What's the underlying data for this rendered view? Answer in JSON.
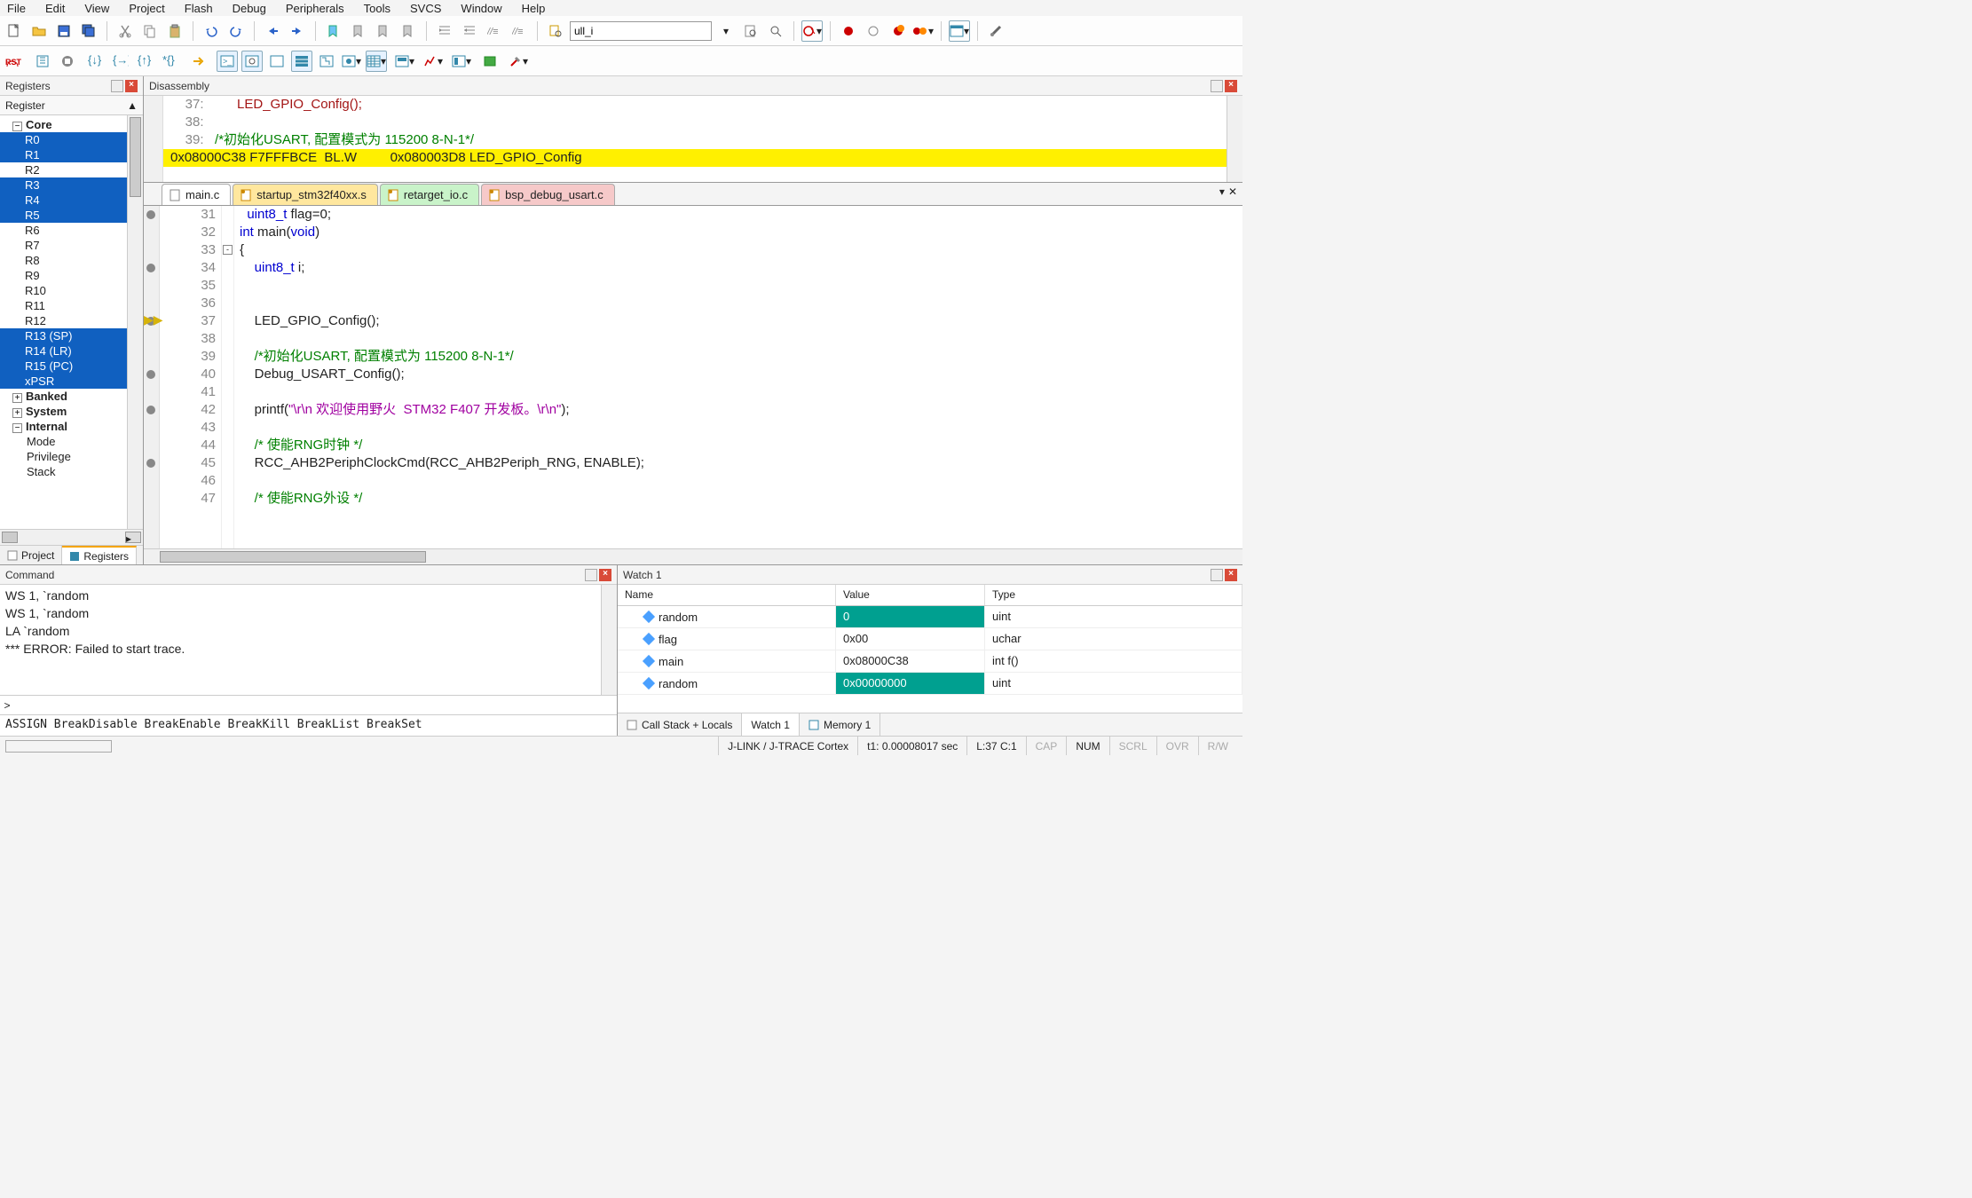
{
  "menu": [
    "File",
    "Edit",
    "View",
    "Project",
    "Flash",
    "Debug",
    "Peripherals",
    "Tools",
    "SVCS",
    "Window",
    "Help"
  ],
  "toolbar_input": "ull_i",
  "registers": {
    "panel_title": "Registers",
    "head": "Register",
    "core": "Core",
    "rows": [
      {
        "t": "R0",
        "s": true
      },
      {
        "t": "R1",
        "s": true
      },
      {
        "t": "R2",
        "s": false
      },
      {
        "t": "R3",
        "s": true
      },
      {
        "t": "R4",
        "s": true
      },
      {
        "t": "R5",
        "s": true
      },
      {
        "t": "R6",
        "s": false
      },
      {
        "t": "R7",
        "s": false
      },
      {
        "t": "R8",
        "s": false
      },
      {
        "t": "R9",
        "s": false
      },
      {
        "t": "R10",
        "s": false
      },
      {
        "t": "R11",
        "s": false
      },
      {
        "t": "R12",
        "s": false
      },
      {
        "t": "R13 (SP)",
        "s": true
      },
      {
        "t": "R14 (LR)",
        "s": true
      },
      {
        "t": "R15 (PC)",
        "s": true
      },
      {
        "t": "xPSR",
        "s": true
      }
    ],
    "groups": [
      "Banked",
      "System",
      "Internal"
    ],
    "internal": [
      "Mode",
      "Privilege",
      "Stack"
    ],
    "tabs": {
      "project": "Project",
      "registers": "Registers"
    }
  },
  "disasm": {
    "title": "Disassembly",
    "lines": [
      {
        "n": "    37:",
        "txt": "         LED_GPIO_Config();",
        "cls": "fn"
      },
      {
        "n": "    38:",
        "txt": "",
        "cls": ""
      },
      {
        "n": "    39:",
        "txt": "   /*初始化USART, 配置模式为 115200 8-N-1*/",
        "cls": "cm"
      }
    ],
    "current": "0x08000C38 F7FFFBCE  BL.W         0x080003D8 LED_GPIO_Config"
  },
  "tabs": [
    {
      "label": "main.c",
      "cls": "c1"
    },
    {
      "label": "startup_stm32f40xx.s",
      "cls": "c2"
    },
    {
      "label": "retarget_io.c",
      "cls": "c3"
    },
    {
      "label": "bsp_debug_usart.c",
      "cls": "c4"
    }
  ],
  "code": {
    "start": 31,
    "lines": [
      {
        "n": 31,
        "html": "  <span class='ty'>uint8_t</span> flag=0;",
        "bp": true
      },
      {
        "n": 32,
        "html": "<span class='kw'>int</span> main(<span class='kw'>void</span>)"
      },
      {
        "n": 33,
        "html": "{",
        "fold": "-"
      },
      {
        "n": 34,
        "html": "    <span class='ty'>uint8_t</span> i;",
        "bp": true
      },
      {
        "n": 35,
        "html": ""
      },
      {
        "n": 36,
        "html": ""
      },
      {
        "n": 37,
        "html": "    LED_GPIO_Config();",
        "cur": true,
        "bp": true
      },
      {
        "n": 38,
        "html": ""
      },
      {
        "n": 39,
        "html": "    <span class='cm'>/*初始化USART, 配置模式为 115200 8-N-1*/</span>"
      },
      {
        "n": 40,
        "html": "    Debug_USART_Config();",
        "bp": true
      },
      {
        "n": 41,
        "html": ""
      },
      {
        "n": 42,
        "html": "    printf(<span class='str'>\"\\r\\n 欢迎使用野火  STM32 F407 开发板。\\r\\n\"</span>);",
        "bp": true
      },
      {
        "n": 43,
        "html": ""
      },
      {
        "n": 44,
        "html": "    <span class='cm'>/* 使能RNG时钟 */</span>"
      },
      {
        "n": 45,
        "html": "    RCC_AHB2PeriphClockCmd(RCC_AHB2Periph_RNG, ENABLE);",
        "bp": true
      },
      {
        "n": 46,
        "html": ""
      },
      {
        "n": 47,
        "html": "    <span class='cm'>/* 使能RNG外设 */</span>"
      }
    ]
  },
  "command": {
    "title": "Command",
    "lines": [
      "WS 1, `random",
      "WS 1, `random",
      "LA `random",
      "*** ERROR: Failed to start trace."
    ],
    "hint": "ASSIGN BreakDisable BreakEnable BreakKill BreakList BreakSet"
  },
  "watch": {
    "title": "Watch 1",
    "headers": {
      "name": "Name",
      "value": "Value",
      "type": "Type"
    },
    "rows": [
      {
        "name": "random",
        "value": "0",
        "type": "uint",
        "sel": true
      },
      {
        "name": "flag",
        "value": "0x00",
        "type": "uchar"
      },
      {
        "name": "main",
        "value": "0x08000C38",
        "type": "int f()"
      },
      {
        "name": "random",
        "value": "0x00000000",
        "type": "uint",
        "sel": true
      }
    ],
    "tabs": [
      "Call Stack + Locals",
      "Watch 1",
      "Memory 1"
    ]
  },
  "status": {
    "debugger": "J-LINK / J-TRACE Cortex",
    "time": "t1: 0.00008017 sec",
    "pos": "L:37 C:1",
    "flags": [
      "CAP",
      "NUM",
      "SCRL",
      "OVR",
      "R/W"
    ]
  }
}
